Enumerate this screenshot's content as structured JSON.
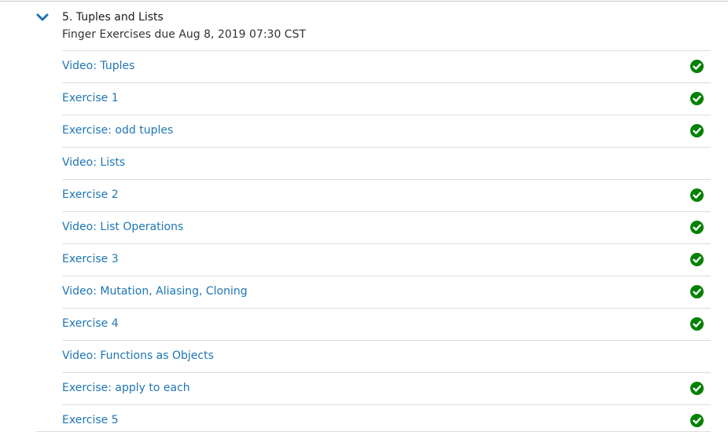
{
  "section": {
    "title": "5. Tuples and Lists",
    "subtitle": "Finger Exercises due Aug 8, 2019 07:30 CST",
    "expanded": true
  },
  "colors": {
    "link": "#1e76b4",
    "check": "#008100",
    "divider": "#dddddd"
  },
  "units": [
    {
      "label": "Video: Tuples",
      "completed": true
    },
    {
      "label": "Exercise 1",
      "completed": true
    },
    {
      "label": "Exercise: odd tuples",
      "completed": true
    },
    {
      "label": "Video: Lists",
      "completed": false
    },
    {
      "label": "Exercise 2",
      "completed": true
    },
    {
      "label": "Video: List Operations",
      "completed": true
    },
    {
      "label": "Exercise 3",
      "completed": true
    },
    {
      "label": "Video: Mutation, Aliasing, Cloning",
      "completed": true
    },
    {
      "label": "Exercise 4",
      "completed": true
    },
    {
      "label": "Video: Functions as Objects",
      "completed": false
    },
    {
      "label": "Exercise: apply to each",
      "completed": true
    },
    {
      "label": "Exercise 5",
      "completed": true
    }
  ]
}
